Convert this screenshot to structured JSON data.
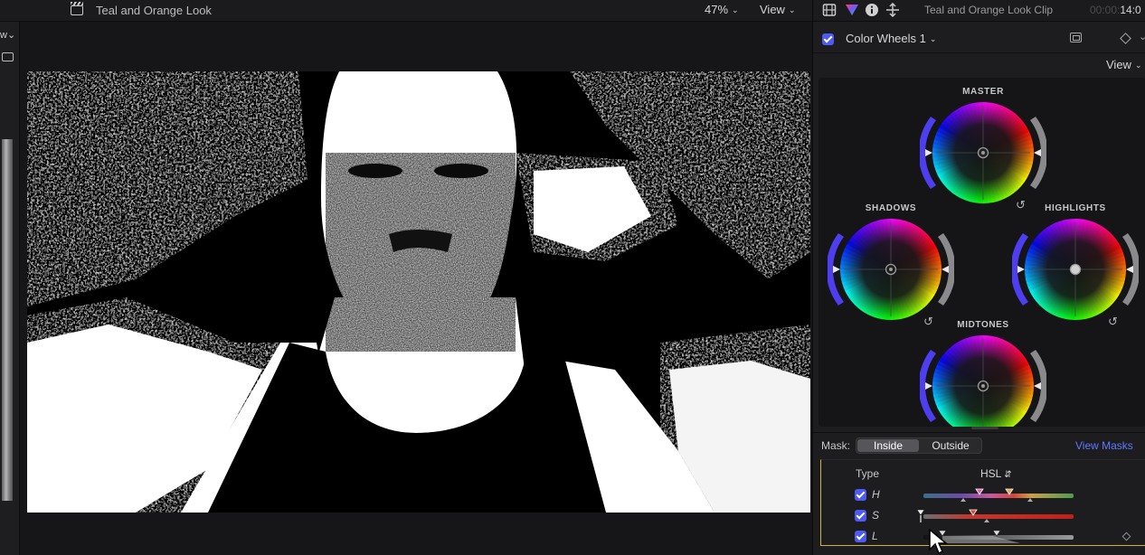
{
  "viewer": {
    "project_title": "Teal and Orange Look",
    "zoom": "47%",
    "view_label": "View",
    "icons": [
      "clapperboard-icon",
      "monitor-icon"
    ]
  },
  "inspector": {
    "clip_title": "Teal and Orange Look Clip",
    "timecode_dim": "00:00:",
    "timecode": "14:0",
    "effect": {
      "enabled": true,
      "name": "Color Wheels 1",
      "view_label": "View"
    },
    "wheels": {
      "master": "MASTER",
      "shadows": "SHADOWS",
      "highlights": "HIGHLIGHTS",
      "midtones": "MIDTONES"
    },
    "mask": {
      "label": "Mask:",
      "options": [
        "Inside",
        "Outside"
      ],
      "selected": "Inside",
      "view_masks": "View Masks"
    },
    "hsl": {
      "type_label": "Type",
      "type_value": "HSL",
      "rows": [
        {
          "letter": "H",
          "enabled": true
        },
        {
          "letter": "S",
          "enabled": true
        },
        {
          "letter": "L",
          "enabled": true
        }
      ]
    }
  },
  "colors": {
    "accent": "#4d5bf2",
    "link": "#5f78ff",
    "panel": "#1d1d20",
    "highlight_border": "#c8b44a"
  }
}
